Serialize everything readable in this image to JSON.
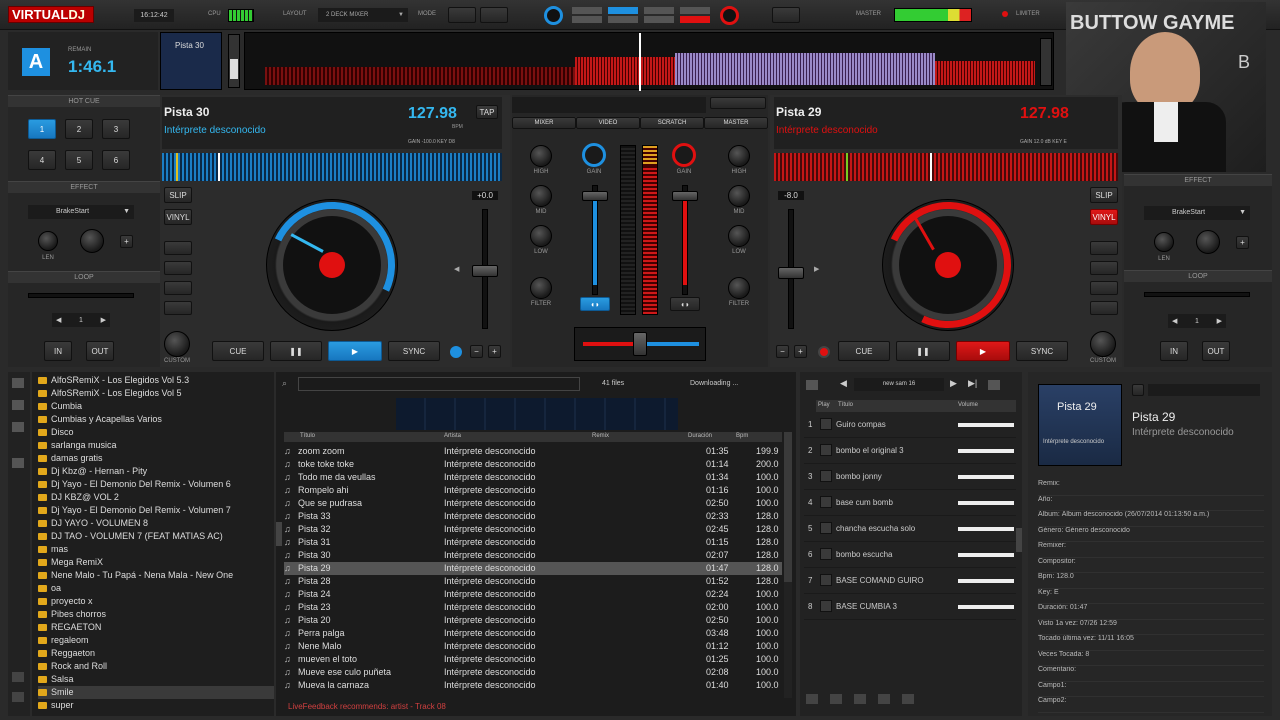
{
  "topbar": {
    "logo_virtual": "VIRTUAL",
    "logo_dj": "DJ",
    "clock": "16:12:42",
    "cpu_label": "CPU",
    "layout_label": "LAYOUT",
    "layout_value": "2 DECK MIXER",
    "mode_label": "MODE",
    "master_label": "MASTER",
    "limiter_label": "LIMITER"
  },
  "webcam": {
    "text": "BUTTOW GAYME"
  },
  "deckA": {
    "letter": "A",
    "remain_label": "REMAIN",
    "time": "1:46.1",
    "overview_title": "Pista 30",
    "title": "Pista 30",
    "artist": "Intérprete desconocido",
    "bpm": "127.98",
    "bpm_unit": "BPM",
    "tap": "TAP",
    "gain": "GAIN  -100.0  KEY  D8",
    "pitch": "+0.0",
    "cue": "CUE",
    "sync": "SYNC",
    "slip": "SLIP",
    "vinyl": "VINYL",
    "hotcue_label": "HOT CUE",
    "hotcues": [
      "1",
      "2",
      "3",
      "4",
      "5",
      "6"
    ],
    "effect_label": "EFFECT",
    "effect_value": "BrakeStart",
    "len": "LEN",
    "loop_label": "LOOP",
    "loop_value": "1",
    "in": "IN",
    "out": "OUT",
    "custom": "CUSTOM"
  },
  "deckB": {
    "letter": "B",
    "title": "Pista 29",
    "artist": "Intérprete desconocido",
    "bpm": "127.98",
    "gain": "GAIN  12.0 dB  KEY  E",
    "pitch": "-8.0",
    "cue": "CUE",
    "sync": "SYNC",
    "slip": "SLIP",
    "vinyl": "VINYL",
    "effect_label": "EFFECT",
    "effect_value": "BrakeStart",
    "len": "LEN",
    "loop_label": "LOOP",
    "loop_value": "1",
    "in": "IN",
    "out": "OUT",
    "custom": "CUSTOM"
  },
  "mixer": {
    "tabs": [
      "MIXER",
      "VIDEO",
      "SCRATCH",
      "MASTER"
    ],
    "eq_labels": [
      "HIGH",
      "MID",
      "LOW",
      "FILTER"
    ],
    "gain": "GAIN"
  },
  "browser": {
    "folders": [
      "AlfoSRemiX - Los Elegidos Vol 5.3",
      "AlfoSRemiX - Los Elegidos Vol 5",
      "Cumbia",
      "Cumbias y Acapellas Varios",
      "Disco",
      "sarlanga musica",
      "damas gratis",
      "Dj Kbz@ - Hernan - Pity",
      "Dj Yayo - El Demonio Del Remix - Volumen 6",
      "DJ KBZ@ VOL 2",
      "Dj Yayo - El Demonio Del Remix - Volumen 7",
      "DJ YAYO - VOLUMEN 8",
      "DJ TAO - VOLUMEN 7 (FEAT MATIAS AC)",
      "mas",
      "Mega RemiX",
      "Nene Malo - Tu Papá - Nena Mala - New One",
      "oa",
      "proyecto x",
      "Pibes chorros",
      "REGAETON",
      "regaleom",
      "Reggaeton",
      "Rock and Roll",
      "Salsa",
      "Smile",
      "super"
    ],
    "file_count": "41 files",
    "downloading": "Downloading ...",
    "columns": [
      "Título",
      "Artista",
      "Remix",
      "Duración",
      "Bpm"
    ],
    "tracks": [
      [
        "zoom zoom",
        "Intérprete desconocido",
        "01:35",
        "199.9"
      ],
      [
        "toke toke toke",
        "Intérprete desconocido",
        "01:14",
        "200.0"
      ],
      [
        "Todo me da veullas",
        "Intérprete desconocido",
        "01:34",
        "100.0"
      ],
      [
        "Rompelo ahi",
        "Intérprete desconocido",
        "01:16",
        "100.0"
      ],
      [
        "Que se pudrasa",
        "Intérprete desconocido",
        "02:50",
        "100.0"
      ],
      [
        "Pista 33",
        "Intérprete desconocido",
        "02:33",
        "128.0"
      ],
      [
        "Pista 32",
        "Intérprete desconocido",
        "02:45",
        "128.0"
      ],
      [
        "Pista 31",
        "Intérprete desconocido",
        "01:15",
        "128.0"
      ],
      [
        "Pista 30",
        "Intérprete desconocido",
        "02:07",
        "128.0"
      ],
      [
        "Pista 29",
        "Intérprete desconocido",
        "01:47",
        "128.0"
      ],
      [
        "Pista 28",
        "Intérprete desconocido",
        "01:52",
        "128.0"
      ],
      [
        "Pista 24",
        "Intérprete desconocido",
        "02:24",
        "100.0"
      ],
      [
        "Pista 23",
        "Intérprete desconocido",
        "02:00",
        "100.0"
      ],
      [
        "Pista 20",
        "Intérprete desconocido",
        "02:50",
        "100.0"
      ],
      [
        "Perra palga",
        "Intérprete desconocido",
        "03:48",
        "100.0"
      ],
      [
        "Nene Malo",
        "Intérprete desconocido",
        "01:12",
        "100.0"
      ],
      [
        "mueven el toto",
        "Intérprete desconocido",
        "01:25",
        "100.0"
      ],
      [
        "Mueve ese culo puñeta",
        "Intérprete desconocido",
        "02:08",
        "100.0"
      ],
      [
        "Mueva la carnaza",
        "Intérprete desconocido",
        "01:40",
        "100.0"
      ]
    ],
    "selected_index": 9,
    "livefeedback": "LiveFeedback recommends: artist - Track 08"
  },
  "sampler": {
    "bank": "new sam 16",
    "col_play": "Play",
    "col_title": "Título",
    "col_volume": "Volume",
    "items": [
      [
        "1",
        "Guiro compas"
      ],
      [
        "2",
        "bombo el original 3"
      ],
      [
        "3",
        "bombo jonny"
      ],
      [
        "4",
        "base cum bomb"
      ],
      [
        "5",
        "chancha escucha solo"
      ],
      [
        "6",
        "bombo escucha"
      ],
      [
        "7",
        "BASE COMAND GUIRO"
      ],
      [
        "8",
        "BASE CUMBIA 3"
      ]
    ]
  },
  "info": {
    "cover_title": "Pista 29",
    "cover_artist": "Intérprete desconocido",
    "title": "Pista 29",
    "artist": "Intérprete desconocido",
    "fields": [
      "Remix:",
      "Año:",
      "Álbum: Álbum desconocido (26/07/2014 01:13:50 a.m.)",
      "Género: Género desconocido",
      "Remixer:",
      "Compositor:",
      "Bpm: 128.0",
      "Key: E",
      "Duración: 01:47",
      "Visto 1a vez: 07/26 12:59",
      "Tocado última vez: 11/11 16:05",
      "Veces Tocada: 8",
      "Comentario:",
      "Campo1:",
      "Campo2:"
    ]
  },
  "colors": {
    "blue": "#1e90e0",
    "red": "#e01010",
    "cyan": "#34b8f0",
    "folder": "#e2a81b"
  }
}
